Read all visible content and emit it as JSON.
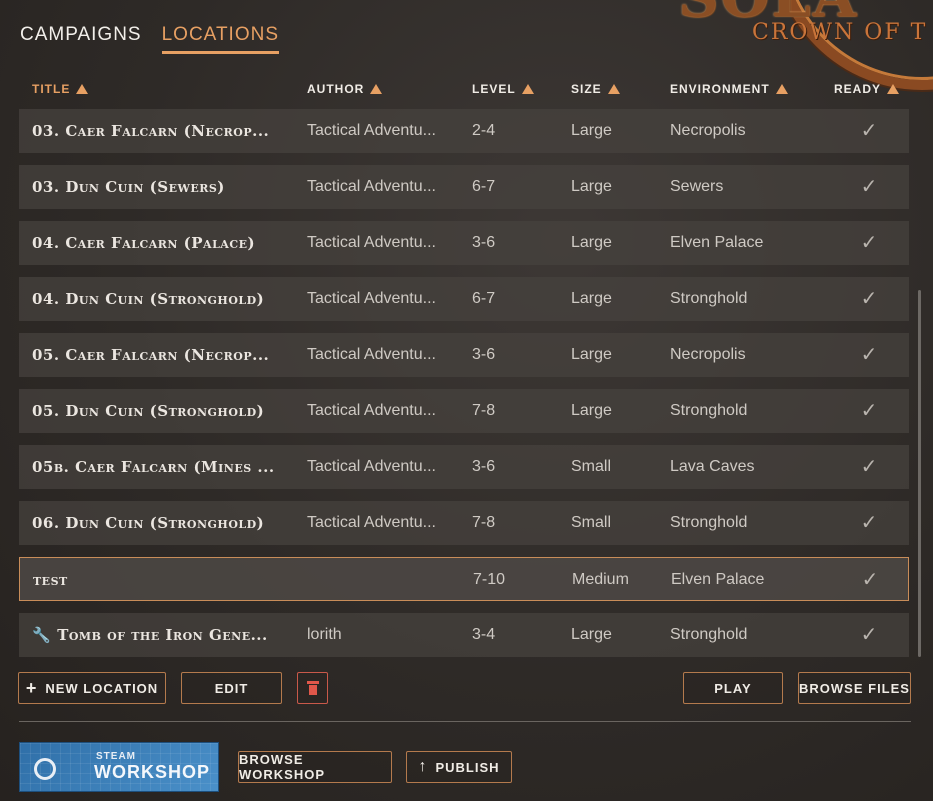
{
  "logo": {
    "big_text": "SOLA",
    "subtitle": "CROWN OF T"
  },
  "tabs": [
    {
      "label": "CAMPAIGNS",
      "active": false
    },
    {
      "label": "LOCATIONS",
      "active": true
    }
  ],
  "columns": {
    "title": "TITLE",
    "author": "AUTHOR",
    "level": "LEVEL",
    "size": "SIZE",
    "environment": "ENVIRONMENT",
    "ready": "READY"
  },
  "rows": [
    {
      "title": "03. Caer Falcarn (Necrop...",
      "author": "Tactical Adventu...",
      "level": "2-4",
      "size": "Large",
      "environment": "Necropolis",
      "ready": "✓",
      "icon": ""
    },
    {
      "title": "03. Dun Cuin (Sewers)",
      "author": "Tactical Adventu...",
      "level": "6-7",
      "size": "Large",
      "environment": "Sewers",
      "ready": "✓",
      "icon": ""
    },
    {
      "title": "04. Caer Falcarn (Palace)",
      "author": "Tactical Adventu...",
      "level": "3-6",
      "size": "Large",
      "environment": "Elven Palace",
      "ready": "✓",
      "icon": ""
    },
    {
      "title": "04. Dun Cuin (Stronghold)",
      "author": "Tactical Adventu...",
      "level": "6-7",
      "size": "Large",
      "environment": "Stronghold",
      "ready": "✓",
      "icon": ""
    },
    {
      "title": "05. Caer Falcarn (Necrop...",
      "author": "Tactical Adventu...",
      "level": "3-6",
      "size": "Large",
      "environment": "Necropolis",
      "ready": "✓",
      "icon": ""
    },
    {
      "title": "05. Dun Cuin (Stronghold)",
      "author": "Tactical Adventu...",
      "level": "7-8",
      "size": "Large",
      "environment": "Stronghold",
      "ready": "✓",
      "icon": ""
    },
    {
      "title": "05b. Caer Falcarn (Mines ...",
      "author": "Tactical Adventu...",
      "level": "3-6",
      "size": "Small",
      "environment": "Lava Caves",
      "ready": "✓",
      "icon": ""
    },
    {
      "title": "06. Dun Cuin (Stronghold)",
      "author": "Tactical Adventu...",
      "level": "7-8",
      "size": "Small",
      "environment": "Stronghold",
      "ready": "✓",
      "icon": ""
    },
    {
      "title": "test",
      "author": "",
      "level": "7-10",
      "size": "Medium",
      "environment": "Elven Palace",
      "ready": "✓",
      "icon": "",
      "selected": true
    },
    {
      "title": "Tomb of the Iron Gene...",
      "author": "lorith",
      "level": "3-4",
      "size": "Large",
      "environment": "Stronghold",
      "ready": "✓",
      "icon": "🔧"
    }
  ],
  "buttons": {
    "new_location": "NEW LOCATION",
    "edit": "EDIT",
    "play": "PLAY",
    "browse_files": "BROWSE FILES",
    "browse_workshop": "BROWSE WORKSHOP",
    "publish": "PUBLISH"
  },
  "steam": {
    "line1": "STEAM",
    "line2": "WORKSHOP"
  },
  "icons": {
    "sort": "triangle-up-icon",
    "delete": "trash-icon",
    "add": "plus-icon",
    "upload": "arrow-up-icon",
    "ready": "check-icon",
    "custom": "wrench-icon"
  },
  "colors": {
    "accent": "#e7a063",
    "danger": "#e0574a",
    "steam": "#3b80bd"
  }
}
